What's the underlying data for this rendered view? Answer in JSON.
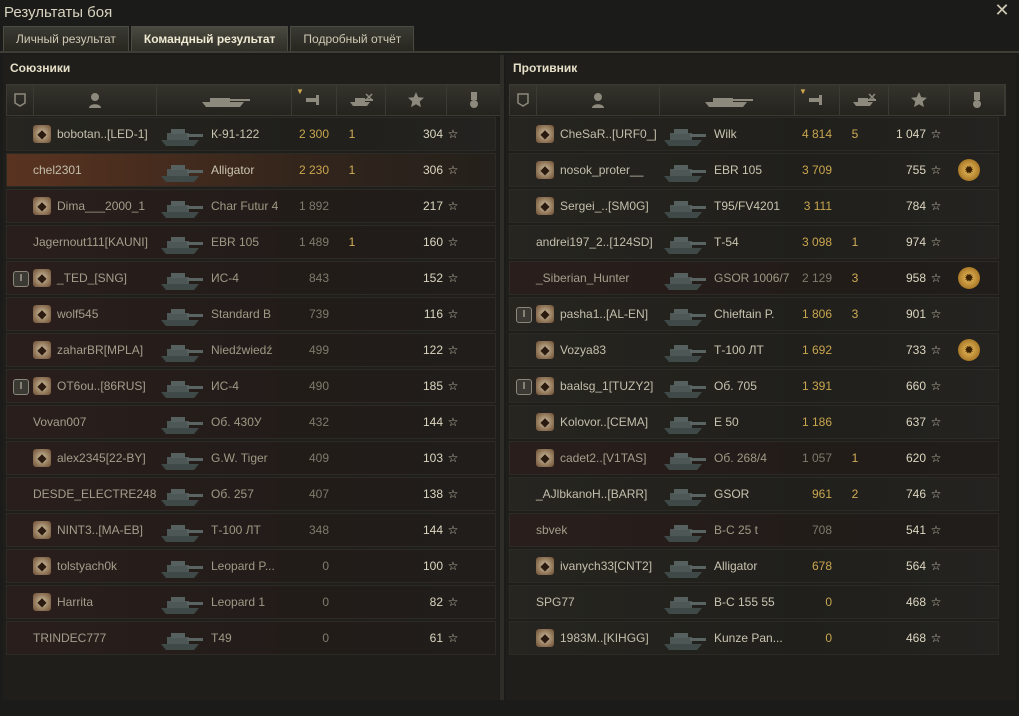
{
  "window": {
    "title": "Результаты боя",
    "close_icon": "close-icon"
  },
  "tabs": [
    {
      "label": "Личный результат",
      "active": false
    },
    {
      "label": "Командный результат",
      "active": true
    },
    {
      "label": "Подробный отчёт",
      "active": false
    }
  ],
  "columns": {
    "icons": [
      "platoon-icon",
      "player-icon",
      "tank-icon",
      "damage-icon",
      "kills-icon",
      "xp-star-icon",
      "medal-icon"
    ],
    "sorted_column": "damage"
  },
  "allies": {
    "title": "Союзники",
    "players": [
      {
        "platoon": "",
        "emblem": "clan-emblem-icon",
        "name": "bobotan..[LED-1]",
        "vehicle": "К-91-122",
        "damage": "2 300",
        "kills": "1",
        "xp": "304",
        "medal": "",
        "state": "alive"
      },
      {
        "platoon": "",
        "emblem": "",
        "name": "chel2301",
        "vehicle": "Alligator",
        "damage": "2 230",
        "kills": "1",
        "xp": "306",
        "medal": "",
        "state": "self"
      },
      {
        "platoon": "",
        "emblem": "clan-emblem-icon",
        "name": "Dima___2000_1",
        "vehicle": "Char Futur 4",
        "damage": "1 892",
        "kills": "",
        "xp": "217",
        "medal": "",
        "state": "dead"
      },
      {
        "platoon": "",
        "emblem": "",
        "name": "Jagernout111[KAUNI]",
        "vehicle": "EBR 105",
        "damage": "1 489",
        "kills": "1",
        "xp": "160",
        "medal": "",
        "state": "dead"
      },
      {
        "platoon": "I",
        "emblem": "clan-emblem-icon",
        "name": "_TED_[SNG]",
        "vehicle": "ИС-4",
        "damage": "843",
        "kills": "",
        "xp": "152",
        "medal": "",
        "state": "dead"
      },
      {
        "platoon": "",
        "emblem": "clan-emblem-icon",
        "name": "wolf545",
        "vehicle": "Standard B",
        "damage": "739",
        "kills": "",
        "xp": "116",
        "medal": "",
        "state": "dead"
      },
      {
        "platoon": "",
        "emblem": "clan-emblem-icon",
        "name": "zaharBR[MPLA]",
        "vehicle": "Niedźwiedź",
        "damage": "499",
        "kills": "",
        "xp": "122",
        "medal": "",
        "state": "dead"
      },
      {
        "platoon": "I",
        "emblem": "clan-emblem-icon",
        "name": "OT6ou..[86RUS]",
        "vehicle": "ИС-4",
        "damage": "490",
        "kills": "",
        "xp": "185",
        "medal": "",
        "state": "dead"
      },
      {
        "platoon": "",
        "emblem": "",
        "name": "Vovan007",
        "vehicle": "Об. 430У",
        "damage": "432",
        "kills": "",
        "xp": "144",
        "medal": "",
        "state": "dead"
      },
      {
        "platoon": "",
        "emblem": "clan-emblem-icon",
        "name": "alex2345[22-BY]",
        "vehicle": "G.W. Tiger",
        "damage": "409",
        "kills": "",
        "xp": "103",
        "medal": "",
        "state": "dead"
      },
      {
        "platoon": "",
        "emblem": "",
        "name": "DESDE_ELECTRE248",
        "vehicle": "Об. 257",
        "damage": "407",
        "kills": "",
        "xp": "138",
        "medal": "",
        "state": "dead"
      },
      {
        "platoon": "",
        "emblem": "clan-emblem-icon",
        "name": "NINT3..[MA-EB]",
        "vehicle": "Т-100 ЛТ",
        "damage": "348",
        "kills": "",
        "xp": "144",
        "medal": "",
        "state": "dead"
      },
      {
        "platoon": "",
        "emblem": "clan-emblem-icon",
        "name": "tolstyach0k",
        "vehicle": "Leopard P...",
        "damage": "0",
        "kills": "",
        "xp": "100",
        "medal": "",
        "state": "dead"
      },
      {
        "platoon": "",
        "emblem": "clan-emblem-icon",
        "name": "Harrita",
        "vehicle": "Leopard 1",
        "damage": "0",
        "kills": "",
        "xp": "82",
        "medal": "",
        "state": "dead"
      },
      {
        "platoon": "",
        "emblem": "",
        "name": "TRINDEC777",
        "vehicle": "T49",
        "damage": "0",
        "kills": "",
        "xp": "61",
        "medal": "",
        "state": "dead"
      }
    ]
  },
  "enemies": {
    "title": "Противник",
    "players": [
      {
        "platoon": "",
        "emblem": "clan-emblem-icon",
        "name": "CheSaR..[URF0_]",
        "vehicle": "Wilk",
        "damage": "4 814",
        "kills": "5",
        "xp": "1 047",
        "medal": "",
        "state": "alive"
      },
      {
        "platoon": "",
        "emblem": "clan-emblem-icon",
        "name": "nosok_proter__",
        "vehicle": "EBR 105",
        "damage": "3 709",
        "kills": "",
        "xp": "755",
        "medal": "medal-icon",
        "state": "alive"
      },
      {
        "platoon": "",
        "emblem": "clan-emblem-icon",
        "name": "Sergei_..[SM0G]",
        "vehicle": "T95/FV4201",
        "damage": "3 111",
        "kills": "",
        "xp": "784",
        "medal": "",
        "state": "alive"
      },
      {
        "platoon": "",
        "emblem": "",
        "name": "andrei197_2..[124SD]",
        "vehicle": "Т-54",
        "damage": "3 098",
        "kills": "1",
        "xp": "974",
        "medal": "",
        "state": "alive"
      },
      {
        "platoon": "",
        "emblem": "",
        "name": "_Siberian_Hunter",
        "vehicle": "GSOR 1006/7",
        "damage": "2 129",
        "kills": "3",
        "xp": "958",
        "medal": "medal-icon",
        "state": "dead"
      },
      {
        "platoon": "I",
        "emblem": "clan-emblem-icon",
        "name": "pasha1..[AL-EN]",
        "vehicle": "Chieftain P.",
        "damage": "1 806",
        "kills": "3",
        "xp": "901",
        "medal": "",
        "state": "alive"
      },
      {
        "platoon": "",
        "emblem": "clan-emblem-icon",
        "name": "Vozya83",
        "vehicle": "Т-100 ЛТ",
        "damage": "1 692",
        "kills": "",
        "xp": "733",
        "medal": "medal-icon",
        "state": "alive"
      },
      {
        "platoon": "I",
        "emblem": "clan-emblem-icon",
        "name": "baalsg_1[TUZY2]",
        "vehicle": "Об. 705",
        "damage": "1 391",
        "kills": "",
        "xp": "660",
        "medal": "",
        "state": "alive"
      },
      {
        "platoon": "",
        "emblem": "clan-emblem-icon",
        "name": "Kolovor..[CEMA]",
        "vehicle": "E 50",
        "damage": "1 186",
        "kills": "",
        "xp": "637",
        "medal": "",
        "state": "alive"
      },
      {
        "platoon": "",
        "emblem": "clan-emblem-icon",
        "name": "cadet2..[V1TAS]",
        "vehicle": "Об. 268/4",
        "damage": "1 057",
        "kills": "1",
        "xp": "620",
        "medal": "",
        "state": "dead"
      },
      {
        "platoon": "",
        "emblem": "",
        "name": "_AJlbkanoH..[BARR]",
        "vehicle": "GSOR",
        "damage": "961",
        "kills": "2",
        "xp": "746",
        "medal": "",
        "state": "alive"
      },
      {
        "platoon": "",
        "emblem": "",
        "name": "sbvek",
        "vehicle": "B-C 25 t",
        "damage": "708",
        "kills": "",
        "xp": "541",
        "medal": "",
        "state": "dead"
      },
      {
        "platoon": "",
        "emblem": "clan-emblem-icon",
        "name": "ivanych33[CNT2]",
        "vehicle": "Alligator",
        "damage": "678",
        "kills": "",
        "xp": "564",
        "medal": "",
        "state": "alive"
      },
      {
        "platoon": "",
        "emblem": "",
        "name": "SPG77",
        "vehicle": "B-C 155 55",
        "damage": "0",
        "kills": "",
        "xp": "468",
        "medal": "",
        "state": "alive"
      },
      {
        "platoon": "",
        "emblem": "clan-emblem-icon",
        "name": "1983M..[KIHGG]",
        "vehicle": "Kunze Pan...",
        "damage": "0",
        "kills": "",
        "xp": "468",
        "medal": "",
        "state": "alive"
      }
    ]
  }
}
